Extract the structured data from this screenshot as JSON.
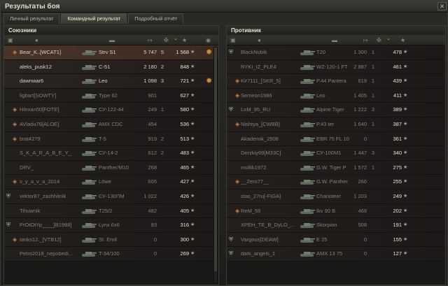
{
  "window": {
    "title": "Результаты боя",
    "close_label": "✕"
  },
  "tabs": [
    "Личный результат",
    "Командный результат",
    "Подробный отчёт"
  ],
  "allies": {
    "title": "Союзники",
    "rows": [
      {
        "name": "Bear_K..[WCAT1]",
        "tank": "Strv S1",
        "dmg": "5 747",
        "frags": "5",
        "xp": "1 568",
        "state": "self",
        "platoon": true,
        "medal": true
      },
      {
        "name": "aleks_pusk12",
        "tank": "C-51",
        "dmg": "2 180",
        "frags": "2",
        "xp": "848",
        "state": "alive",
        "platoon": false,
        "medal": false
      },
      {
        "name": "dawnwar6",
        "tank": "Leo",
        "dmg": "1 098",
        "frags": "3",
        "xp": "721",
        "state": "alive",
        "platoon": false,
        "medal": true
      },
      {
        "name": "ligbart[SOWTY]",
        "tank": "Type 62",
        "dmg": "901",
        "frags": "",
        "xp": "627",
        "state": "dead",
        "platoon": false,
        "medal": false
      },
      {
        "name": "Hitman50[FOTE]",
        "tank": "СУ-122-44",
        "dmg": "249",
        "frags": "1",
        "xp": "580",
        "state": "dead",
        "platoon": true,
        "medal": false
      },
      {
        "name": "AVladu76[ALOE]",
        "tank": "AMX CDC",
        "dmg": "454",
        "frags": "",
        "xp": "536",
        "state": "dead",
        "platoon": true,
        "medal": false
      },
      {
        "name": "brat4279",
        "tank": "T-5",
        "dmg": "919",
        "frags": "2",
        "xp": "513",
        "state": "dead",
        "platoon": true,
        "medal": false
      },
      {
        "name": "S_K_A_R_A_B_E_Y_",
        "tank": "СУ-14-2",
        "dmg": "612",
        "frags": "2",
        "xp": "483",
        "state": "dead",
        "platoon": false,
        "medal": false
      },
      {
        "name": "DRV_",
        "tank": "Panther/M10",
        "dmg": "268",
        "frags": "",
        "xp": "465",
        "state": "dead",
        "platoon": false,
        "medal": false
      },
      {
        "name": "s_y_a_v_a_2014",
        "tank": "Löwe",
        "dmg": "605",
        "frags": "",
        "xp": "427",
        "state": "dead",
        "platoon": true,
        "medal": false
      },
      {
        "name": "vektor87_zashhitnik",
        "tank": "СУ-130ПМ",
        "dmg": "1 022",
        "frags": "",
        "xp": "426",
        "state": "dead",
        "platoon": false,
        "medal": false,
        "clan_icon": true
      },
      {
        "name": "Tihuwnik",
        "tank": "T25/2",
        "dmg": "482",
        "frags": "",
        "xp": "405",
        "state": "dead",
        "platoon": false,
        "medal": false
      },
      {
        "name": "PrOtOtYp____[B1988]",
        "tank": "Lynx 6x6",
        "dmg": "93",
        "frags": "",
        "xp": "316",
        "state": "dead",
        "platoon": false,
        "medal": false,
        "clan_icon": true
      },
      {
        "name": "tanks12._[VTB12]",
        "tank": "St. Emil",
        "dmg": "0",
        "frags": "",
        "xp": "300",
        "state": "dead",
        "platoon": true,
        "medal": false
      },
      {
        "name": "Petro2018_nepobedi...",
        "tank": "T-34/100",
        "dmg": "0",
        "frags": "",
        "xp": "269",
        "state": "dead",
        "platoon": false,
        "medal": false
      }
    ]
  },
  "enemies": {
    "title": "Противник",
    "rows": [
      {
        "name": "BlackNubik",
        "tank": "T20",
        "dmg": "1 300",
        "frags": "1",
        "xp": "478",
        "state": "dead",
        "platoon": false,
        "clan_icon": true
      },
      {
        "name": "RYKI_IZ_PLE4",
        "tank": "WZ-120-1 FT",
        "dmg": "2 887",
        "frags": "1",
        "xp": "461",
        "state": "dead",
        "platoon": false
      },
      {
        "name": "Kir7111_[SKR_5]",
        "tank": "P.44 Pantera",
        "dmg": "619",
        "frags": "1",
        "xp": "439",
        "state": "dead",
        "platoon": true
      },
      {
        "name": "Semeon1986",
        "tank": "Leo",
        "dmg": "1 405",
        "frags": "1",
        "xp": "411",
        "state": "dead",
        "platoon": true
      },
      {
        "name": "LoM_95_RU",
        "tank": "Alpine Tiger",
        "dmg": "1 222",
        "frags": "3",
        "xp": "389",
        "state": "dead",
        "platoon": false,
        "clan_icon": true
      },
      {
        "name": "Nishtya_[CWBB]",
        "tank": "P.43 ter",
        "dmg": "1 640",
        "frags": "1",
        "xp": "387",
        "state": "dead",
        "platoon": true
      },
      {
        "name": "Akademik_2908",
        "tank": "EBR 75 FL 10",
        "dmg": "0",
        "frags": "",
        "xp": "361",
        "state": "dead",
        "platoon": false
      },
      {
        "name": "Derzkiy69[M33C]",
        "tank": "СУ-100М1",
        "dmg": "1 447",
        "frags": "3",
        "xp": "340",
        "state": "dead",
        "platoon": false
      },
      {
        "name": "multik1972",
        "tank": "G.W. Tiger P",
        "dmg": "1 572",
        "frags": "1",
        "xp": "275",
        "state": "dead",
        "platoon": false
      },
      {
        "name": "__Zero77__",
        "tank": "G.W. Panther",
        "dmg": "266",
        "frags": "",
        "xp": "255",
        "state": "dead",
        "platoon": true
      },
      {
        "name": "stas_27ru[-FIGA]",
        "tank": "Charioteer",
        "dmg": "1 203",
        "frags": "",
        "xp": "249",
        "state": "dead",
        "platoon": false
      },
      {
        "name": "ReM_56",
        "tank": "Ikv 90 B",
        "dmg": "469",
        "frags": "",
        "xp": "202",
        "state": "dead",
        "platoon": true
      },
      {
        "name": "XPEH_TE_B_DyLO_...",
        "tank": "Skorpion",
        "dmg": "508",
        "frags": "",
        "xp": "191",
        "state": "dead",
        "platoon": false
      },
      {
        "name": "Vargous[DEAW]",
        "tank": "E 25",
        "dmg": "0",
        "frags": "",
        "xp": "155",
        "state": "dead",
        "platoon": false,
        "clan_icon": true
      },
      {
        "name": "dark_angels_1",
        "tank": "AMX 13 75",
        "dmg": "0",
        "frags": "",
        "xp": "127",
        "state": "dead",
        "platoon": false,
        "clan_icon": true
      }
    ]
  },
  "icons": {
    "star": "★",
    "medal": "✹",
    "platoon": "◈",
    "clan": "⛨",
    "sort": "⌄"
  },
  "colors": {
    "accent": "#c9a85a",
    "self_row": "#4a3428",
    "row": "#2a2422"
  }
}
